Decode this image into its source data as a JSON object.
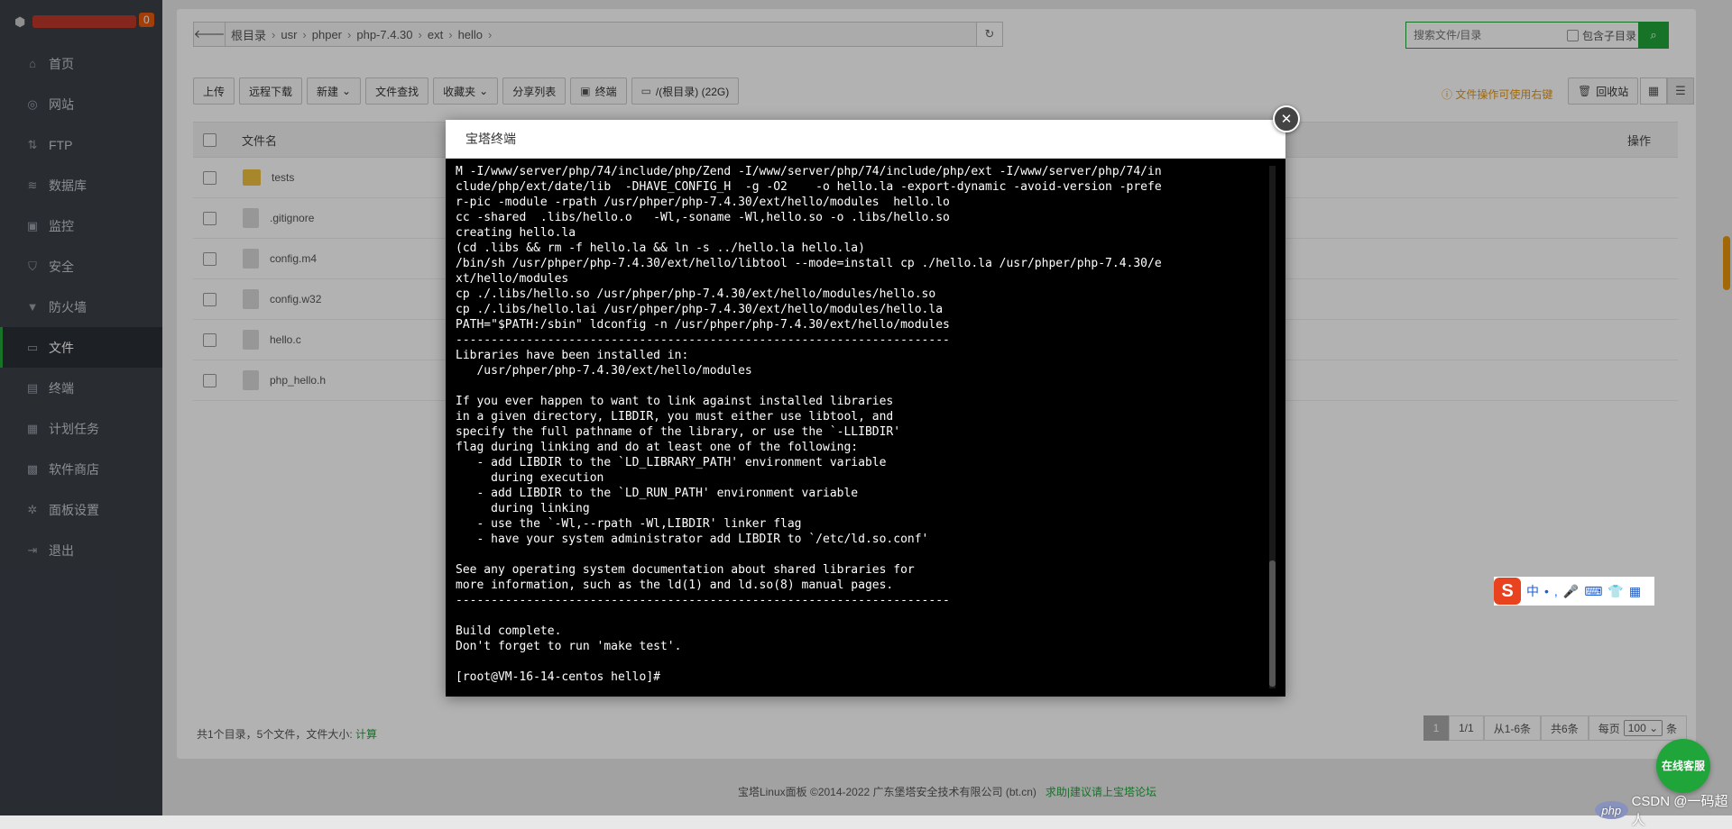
{
  "sidebar": {
    "badge": "0",
    "items": [
      {
        "label": "首页",
        "icon": "home-icon",
        "glyph": "⌂"
      },
      {
        "label": "网站",
        "icon": "globe-icon",
        "glyph": "◎"
      },
      {
        "label": "FTP",
        "icon": "ftp-icon",
        "glyph": "⇅"
      },
      {
        "label": "数据库",
        "icon": "database-icon",
        "glyph": "≋"
      },
      {
        "label": "监控",
        "icon": "monitor-icon",
        "glyph": "▣"
      },
      {
        "label": "安全",
        "icon": "shield-icon",
        "glyph": "⛉"
      },
      {
        "label": "防火墙",
        "icon": "firewall-icon",
        "glyph": "▼"
      },
      {
        "label": "文件",
        "icon": "folder-icon",
        "glyph": "▭",
        "active": true
      },
      {
        "label": "终端",
        "icon": "terminal-icon",
        "glyph": "▤"
      },
      {
        "label": "计划任务",
        "icon": "calendar-icon",
        "glyph": "▦"
      },
      {
        "label": "软件商店",
        "icon": "apps-icon",
        "glyph": "▩"
      },
      {
        "label": "面板设置",
        "icon": "gear-icon",
        "glyph": "✲"
      },
      {
        "label": "退出",
        "icon": "logout-icon",
        "glyph": "⇥"
      }
    ]
  },
  "path": {
    "crumbs": [
      "根目录",
      "usr",
      "phper",
      "php-7.4.30",
      "ext",
      "hello"
    ]
  },
  "search": {
    "placeholder": "搜索文件/目录",
    "include_subdir": "包含子目录"
  },
  "toolbar": {
    "upload": "上传",
    "remote_download": "远程下载",
    "new": "新建",
    "file_find": "文件查找",
    "favorites": "收藏夹",
    "share_list": "分享列表",
    "terminal": "终端",
    "disk": "/(根目录) (22G)",
    "tip": "文件操作可使用右键",
    "recycle": "回收站"
  },
  "table": {
    "col_name": "文件名",
    "col_ops": "操作",
    "rows": [
      {
        "name": "tests",
        "type": "folder"
      },
      {
        "name": ".gitignore",
        "type": "file"
      },
      {
        "name": "config.m4",
        "type": "file"
      },
      {
        "name": "config.w32",
        "type": "file"
      },
      {
        "name": "hello.c",
        "type": "file"
      },
      {
        "name": "php_hello.h",
        "type": "file"
      }
    ]
  },
  "footer_info": {
    "summary": "共1个目录，5个文件，文件大小:",
    "calc": "计算"
  },
  "pager": {
    "current": "1",
    "pages": "1/1",
    "range": "从1-6条",
    "total": "共6条",
    "per_page_label": "每页",
    "per_page": "100",
    "unit": "条"
  },
  "bottom": {
    "copyright": "宝塔Linux面板 ©2014-2022 广东堡塔安全技术有限公司 (bt.cn)",
    "help": "求助|建议请上宝塔论坛"
  },
  "modal": {
    "title": "宝塔终端",
    "terminal_lines": [
      "M -I/www/server/php/74/include/php/Zend -I/www/server/php/74/include/php/ext -I/www/server/php/74/in",
      "clude/php/ext/date/lib  -DHAVE_CONFIG_H  -g -O2    -o hello.la -export-dynamic -avoid-version -prefe",
      "r-pic -module -rpath /usr/phper/php-7.4.30/ext/hello/modules  hello.lo",
      "cc -shared  .libs/hello.o   -Wl,-soname -Wl,hello.so -o .libs/hello.so",
      "creating hello.la",
      "(cd .libs && rm -f hello.la && ln -s ../hello.la hello.la)",
      "/bin/sh /usr/phper/php-7.4.30/ext/hello/libtool --mode=install cp ./hello.la /usr/phper/php-7.4.30/e",
      "xt/hello/modules",
      "cp ./.libs/hello.so /usr/phper/php-7.4.30/ext/hello/modules/hello.so",
      "cp ./.libs/hello.lai /usr/phper/php-7.4.30/ext/hello/modules/hello.la",
      "PATH=\"$PATH:/sbin\" ldconfig -n /usr/phper/php-7.4.30/ext/hello/modules",
      "----------------------------------------------------------------------",
      "Libraries have been installed in:",
      "   /usr/phper/php-7.4.30/ext/hello/modules",
      "",
      "If you ever happen to want to link against installed libraries",
      "in a given directory, LIBDIR, you must either use libtool, and",
      "specify the full pathname of the library, or use the `-LLIBDIR'",
      "flag during linking and do at least one of the following:",
      "   - add LIBDIR to the `LD_LIBRARY_PATH' environment variable",
      "     during execution",
      "   - add LIBDIR to the `LD_RUN_PATH' environment variable",
      "     during linking",
      "   - use the `-Wl,--rpath -Wl,LIBDIR' linker flag",
      "   - have your system administrator add LIBDIR to `/etc/ld.so.conf'",
      "",
      "See any operating system documentation about shared libraries for",
      "more information, such as the ld(1) and ld.so(8) manual pages.",
      "----------------------------------------------------------------------",
      "",
      "Build complete.",
      "Don't forget to run 'make test'.",
      "",
      "[root@VM-16-14-centos hello]#"
    ]
  },
  "ime": {
    "logo": "S",
    "text": "中•,🎤⌨👕▦"
  },
  "service": "在线客服",
  "watermark": {
    "php": "php",
    "text": "CSDN @一码超人"
  },
  "colors": {
    "accent": "#20a53a",
    "sidebar": "#3b3f47",
    "warning": "#e8960c"
  }
}
